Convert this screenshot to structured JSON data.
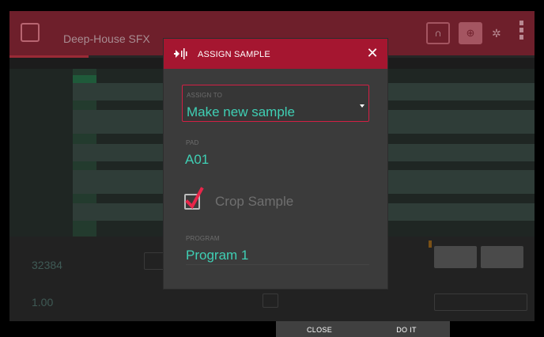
{
  "background_app": {
    "title": "Deep-House SFX",
    "bottom_value_left": "32384",
    "bottom_value_left2": "1.00"
  },
  "modal": {
    "title": "ASSIGN SAMPLE",
    "icon": "assign-sample-icon",
    "close_icon": "close-icon",
    "assign_to": {
      "label": "ASSIGN TO",
      "value": "Make new sample"
    },
    "pad": {
      "label": "PAD",
      "value": "A01"
    },
    "crop_sample": {
      "label": "Crop Sample",
      "checked": true
    },
    "program": {
      "label": "PROGRAM",
      "value": "Program 1"
    }
  },
  "footer": {
    "close_label": "CLOSE",
    "do_it_label": "DO IT"
  },
  "colors": {
    "accent_red": "#a51630",
    "field_border": "#d21f44",
    "value_teal": "#3fcfb4",
    "check_red": "#e8264a"
  }
}
